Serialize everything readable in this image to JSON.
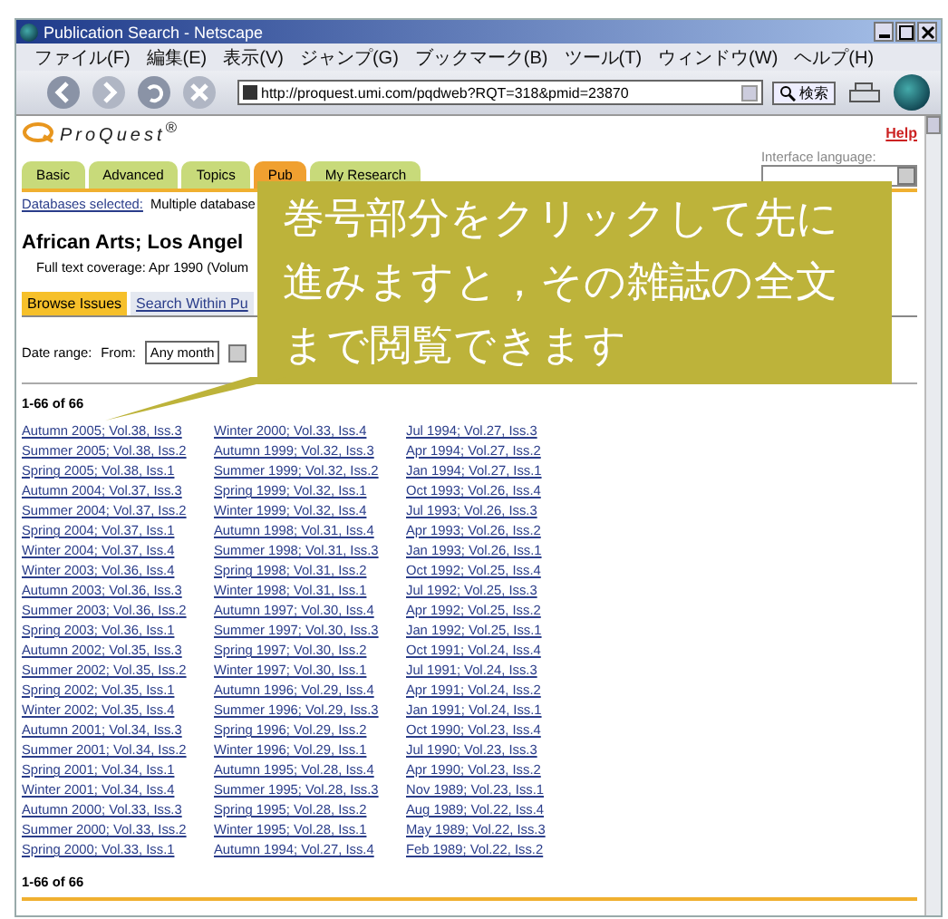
{
  "window": {
    "title": "Publication Search - Netscape"
  },
  "menu": [
    "ファイル(F)",
    "編集(E)",
    "表示(V)",
    "ジャンプ(G)",
    "ブックマーク(B)",
    "ツール(T)",
    "ウィンドウ(W)",
    "ヘルプ(H)"
  ],
  "toolbar": {
    "url": "http://proquest.umi.com/pqdweb?RQT=318&pmid=23870",
    "search_button": "検索"
  },
  "logo": "ProQuest$^{®}$",
  "help": "Help",
  "tabs": [
    {
      "label": "Basic",
      "selected": false
    },
    {
      "label": "Advanced",
      "selected": false
    },
    {
      "label": "Topics",
      "selected": false
    },
    {
      "label": "Pub",
      "selected": true
    },
    {
      "label": "My Research",
      "selected": false
    }
  ],
  "interface_language": {
    "label": "Interface language:"
  },
  "databases": {
    "label": "Databases selected:",
    "value": "Multiple database"
  },
  "publication": {
    "title": "African Arts; Los Angel",
    "coverage": "Full text coverage: Apr 1990 (Volum"
  },
  "subtabs": [
    {
      "label": "Browse Issues",
      "selected": true
    },
    {
      "label": "Search Within Pu",
      "selected": false
    }
  ],
  "date_range": {
    "label": "Date range:",
    "from_label": "From:",
    "from_value": "Any month"
  },
  "count_top": "1-66 of 66",
  "issues": [
    [
      "Autumn 2005; Vol.38, Iss.3",
      "Summer 2005; Vol.38, Iss.2",
      "Spring 2005; Vol.38, Iss.1",
      "Autumn 2004; Vol.37, Iss.3",
      "Summer 2004; Vol.37, Iss.2",
      "Spring 2004; Vol.37, Iss.1",
      "Winter 2004; Vol.37, Iss.4",
      "Winter 2003; Vol.36, Iss.4",
      "Autumn 2003; Vol.36, Iss.3",
      "Summer 2003; Vol.36, Iss.2",
      "Spring 2003; Vol.36, Iss.1",
      "Autumn 2002; Vol.35, Iss.3",
      "Summer 2002; Vol.35, Iss.2",
      "Spring 2002; Vol.35, Iss.1",
      "Winter 2002; Vol.35, Iss.4",
      "Autumn 2001; Vol.34, Iss.3",
      "Summer 2001; Vol.34, Iss.2",
      "Spring 2001; Vol.34, Iss.1",
      "Winter 2001; Vol.34, Iss.4",
      "Autumn 2000; Vol.33, Iss.3",
      "Summer 2000; Vol.33, Iss.2",
      "Spring 2000; Vol.33, Iss.1"
    ],
    [
      "Winter 2000; Vol.33, Iss.4",
      "Autumn 1999; Vol.32, Iss.3",
      "Summer 1999; Vol.32, Iss.2",
      "Spring 1999; Vol.32, Iss.1",
      "Winter 1999; Vol.32, Iss.4",
      "Autumn 1998; Vol.31, Iss.4",
      "Summer 1998; Vol.31, Iss.3",
      "Spring 1998; Vol.31, Iss.2",
      "Winter 1998; Vol.31, Iss.1",
      "Autumn 1997; Vol.30, Iss.4",
      "Summer 1997; Vol.30, Iss.3",
      "Spring 1997; Vol.30, Iss.2",
      "Winter 1997; Vol.30, Iss.1",
      "Autumn 1996; Vol.29, Iss.4",
      "Summer 1996; Vol.29, Iss.3",
      "Spring 1996; Vol.29, Iss.2",
      "Winter 1996; Vol.29, Iss.1",
      "Autumn 1995; Vol.28, Iss.4",
      "Summer 1995; Vol.28, Iss.3",
      "Spring 1995; Vol.28, Iss.2",
      "Winter 1995; Vol.28, Iss.1",
      "Autumn 1994; Vol.27, Iss.4"
    ],
    [
      "Jul 1994; Vol.27, Iss.3",
      "Apr 1994; Vol.27, Iss.2",
      "Jan 1994; Vol.27, Iss.1",
      "Oct 1993; Vol.26, Iss.4",
      "Jul 1993; Vol.26, Iss.3",
      "Apr 1993; Vol.26, Iss.2",
      "Jan 1993; Vol.26, Iss.1",
      "Oct 1992; Vol.25, Iss.4",
      "Jul 1992; Vol.25, Iss.3",
      "Apr 1992; Vol.25, Iss.2",
      "Jan 1992; Vol.25, Iss.1",
      "Oct 1991; Vol.24, Iss.4",
      "Jul 1991; Vol.24, Iss.3",
      "Apr 1991; Vol.24, Iss.2",
      "Jan 1991; Vol.24, Iss.1",
      "Oct 1990; Vol.23, Iss.4",
      "Jul 1990; Vol.23, Iss.3",
      "Apr 1990; Vol.23, Iss.2",
      "Nov 1989; Vol.23, Iss.1",
      "Aug 1989; Vol.22, Iss.4",
      "May 1989; Vol.22, Iss.3",
      "Feb 1989; Vol.22, Iss.2"
    ]
  ],
  "count_bottom": "1-66 of 66",
  "callout": "巻号部分をクリックして先に進みますと，その雑誌の全文まで閲覧できます"
}
